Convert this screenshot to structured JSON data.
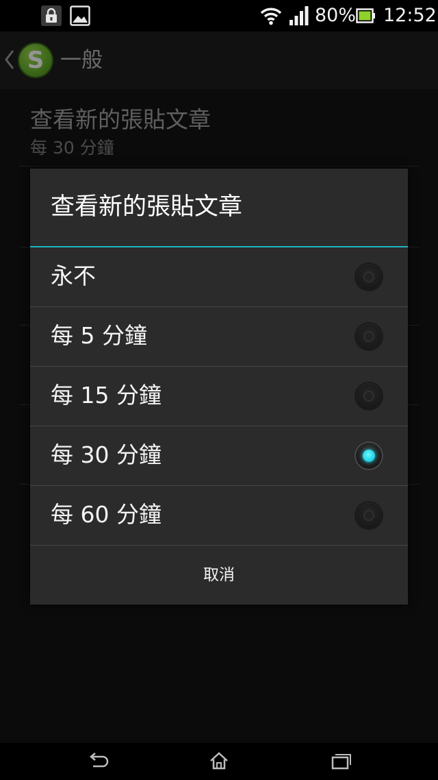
{
  "status_bar": {
    "icons": [
      "lock-icon",
      "image-icon",
      "wifi-icon",
      "signal-icon",
      "battery-icon"
    ],
    "battery_percent": "80%",
    "time": "12:52"
  },
  "action_bar": {
    "back_icon": "chevron-left-icon",
    "app_logo_letter": "S",
    "title": "一般"
  },
  "background_pref": {
    "title": "查看新的張貼文章",
    "summary": "每 30 分鐘"
  },
  "dialog": {
    "title": "查看新的張貼文章",
    "options": [
      {
        "label": "永不",
        "checked": false
      },
      {
        "label": "每 5 分鐘",
        "checked": false
      },
      {
        "label": "每 15 分鐘",
        "checked": false
      },
      {
        "label": "每 30 分鐘",
        "checked": true
      },
      {
        "label": "每 60 分鐘",
        "checked": false
      }
    ],
    "cancel_label": "取消"
  },
  "nav_bar": {
    "icons": [
      "back-arrow-icon",
      "home-icon",
      "recent-apps-icon"
    ]
  },
  "colors": {
    "accent": "#1fb3c3",
    "radio_checked": "#22d6e6",
    "dialog_bg": "#2b2b2b"
  }
}
